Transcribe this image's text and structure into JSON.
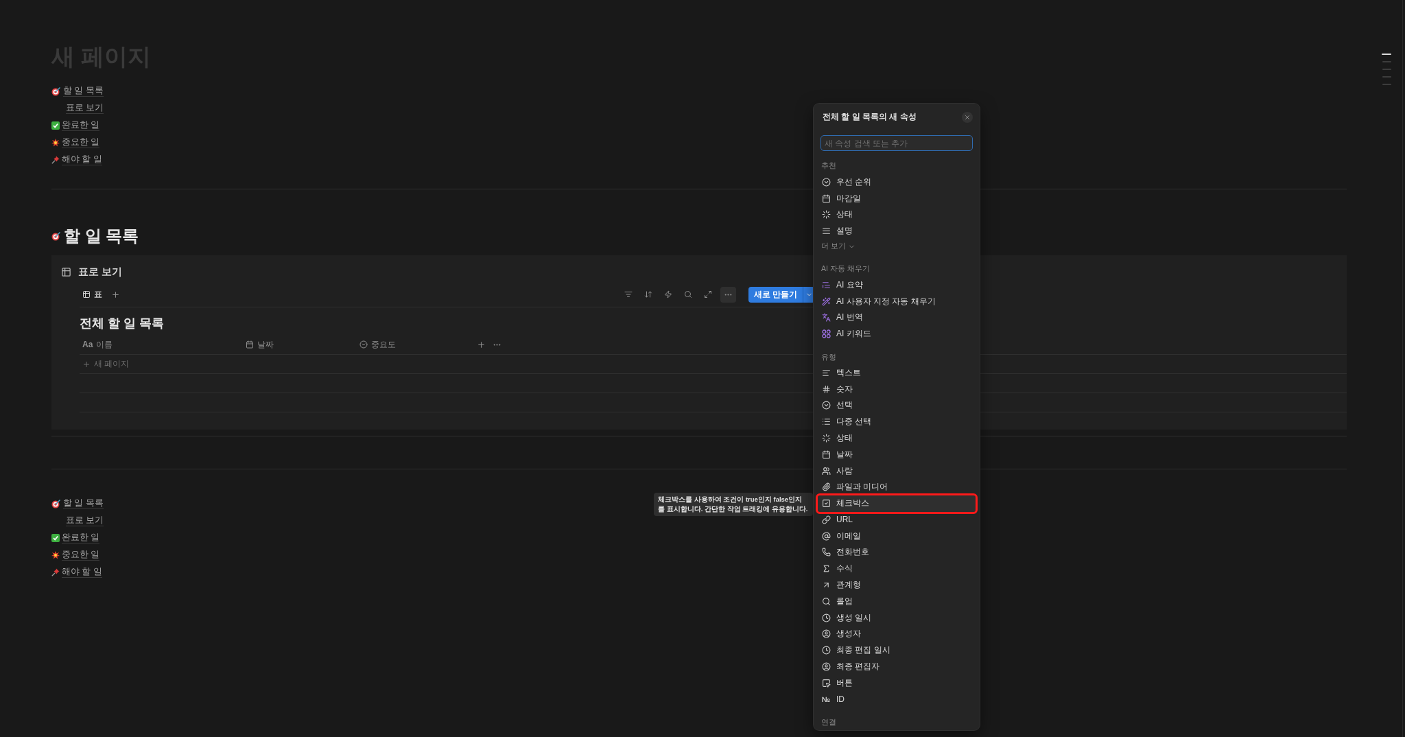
{
  "page": {
    "title": "새 페이지"
  },
  "toc": [
    {
      "text": "할 일 목록",
      "children": [
        {
          "text": "표로 보기"
        }
      ]
    },
    {
      "text": "완료한 일"
    },
    {
      "text": "중요한 일"
    },
    {
      "text": "해야 할 일"
    }
  ],
  "section": {
    "title": "할 일 목록"
  },
  "database": {
    "view_title": "표로 보기",
    "tabs": [
      {
        "label": "표"
      }
    ],
    "title": "전체 할 일 목록",
    "new_button": "새로 만들기",
    "columns": [
      {
        "label": "이름",
        "glyph": "Aa"
      },
      {
        "label": "날짜"
      },
      {
        "label": "중요도"
      }
    ],
    "new_row": "새 페이지"
  },
  "toc_bottom": [
    {
      "text": "할 일 목록",
      "children": [
        {
          "text": "표로 보기"
        }
      ]
    },
    {
      "text": "완료한 일"
    },
    {
      "text": "중요한 일"
    },
    {
      "text": "해야 할 일"
    }
  ],
  "tooltip": "체크박스를 사용하여 조건이 true인지 false인지를 표시합니다. 간단한 작업 트래킹에 유용합니다.",
  "panel": {
    "title": "전체 할 일 목록의 새 속성",
    "search_placeholder": "새 속성 검색 또는 추가",
    "sections": [
      {
        "heading": "추천",
        "more": "더 보기",
        "items": [
          {
            "label": "우선 순위",
            "selected": false
          },
          {
            "label": "마감일",
            "selected": false
          },
          {
            "label": "상태",
            "selected": false
          },
          {
            "label": "설명",
            "selected": false
          }
        ]
      },
      {
        "heading": "AI 자동 채우기",
        "items": [
          {
            "label": "AI 요약",
            "selected": false
          },
          {
            "label": "AI 사용자 지정 자동 채우기",
            "selected": false
          },
          {
            "label": "AI 번역",
            "selected": false
          },
          {
            "label": "AI 키워드",
            "selected": false
          }
        ]
      },
      {
        "heading": "유형",
        "items": [
          {
            "label": "텍스트",
            "selected": false
          },
          {
            "label": "숫자",
            "selected": false
          },
          {
            "label": "선택",
            "selected": false
          },
          {
            "label": "다중 선택",
            "selected": false
          },
          {
            "label": "상태",
            "selected": false
          },
          {
            "label": "날짜",
            "selected": false
          },
          {
            "label": "사람",
            "selected": false
          },
          {
            "label": "파일과 미디어",
            "selected": false
          },
          {
            "label": "체크박스",
            "selected": true
          },
          {
            "label": "URL",
            "selected": false
          },
          {
            "label": "이메일",
            "selected": false
          },
          {
            "label": "전화번호",
            "selected": false
          },
          {
            "label": "수식",
            "selected": false
          },
          {
            "label": "관계형",
            "selected": false
          },
          {
            "label": "롤업",
            "selected": false
          },
          {
            "label": "생성 일시",
            "selected": false
          },
          {
            "label": "생성자",
            "selected": false
          },
          {
            "label": "최종 편집 일시",
            "selected": false
          },
          {
            "label": "최종 편집자",
            "selected": false
          },
          {
            "label": "버튼",
            "selected": false
          },
          {
            "label": "ID",
            "selected": false,
            "glyph": "№"
          }
        ]
      },
      {
        "heading": "연결"
      }
    ]
  },
  "outline": [
    {
      "selected": true
    },
    {
      "selected": false
    },
    {
      "selected": false
    },
    {
      "selected": false
    },
    {
      "selected": false
    }
  ]
}
